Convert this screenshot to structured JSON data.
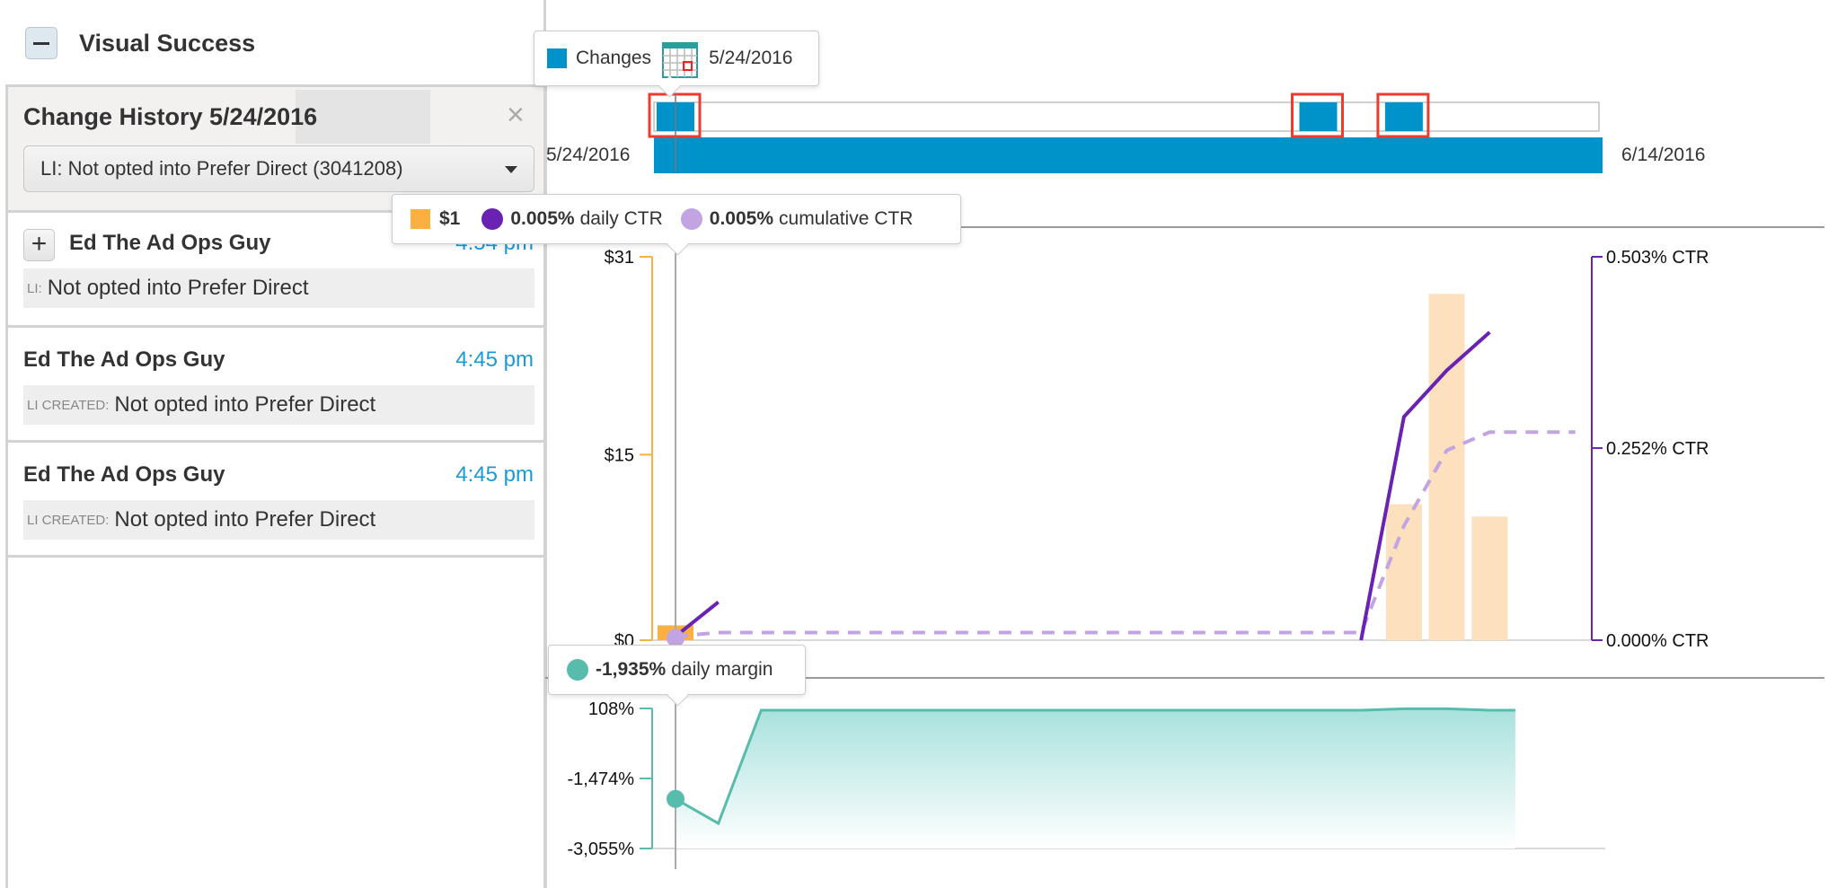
{
  "header": {
    "title": "Visual Success",
    "collapse_icon": "minus-icon"
  },
  "history": {
    "title": "Change History 5/24/2016",
    "close_icon": "close-icon",
    "select_value": "LI: Not opted into Prefer Direct (3041208)",
    "entries": [
      {
        "author": "Ed The Ad Ops Guy",
        "time": "4:54 pm",
        "tag": "LI:",
        "text": "Not opted into Prefer Direct",
        "expandable": true
      },
      {
        "author": "Ed The Ad Ops Guy",
        "time": "4:45 pm",
        "tag": "LI CREATED:",
        "text": "Not opted into Prefer Direct",
        "expandable": false
      },
      {
        "author": "Ed The Ad Ops Guy",
        "time": "4:45 pm",
        "tag": "LI CREATED:",
        "text": "Not opted into Prefer Direct",
        "expandable": false
      }
    ]
  },
  "tooltips": {
    "changes": {
      "label": "Changes",
      "icon": "calendar-icon",
      "date": "5/24/2016"
    },
    "metrics": {
      "spend": "$1",
      "daily_ctr_value": "0.005%",
      "daily_ctr_label": "daily CTR",
      "cum_ctr_value": "0.005%",
      "cum_ctr_label": "cumulative CTR"
    },
    "margin": {
      "value": "-1,935%",
      "label": "daily margin"
    }
  },
  "colors": {
    "changes": "#0093c9",
    "highlight": "#f03a2e",
    "spend": "#fbb040",
    "spend_faded": "#fde0bd",
    "daily_ctr": "#6a22b3",
    "cumulative_ctr": "#c1a4e1",
    "margin": "#58bcad"
  },
  "chart_data": [
    {
      "type": "timeline",
      "title": "Changes",
      "start_label": "5/24/2016",
      "end_label": "6/14/2016",
      "days": 22,
      "change_days": [
        0,
        15,
        17
      ],
      "highlighted_days": [
        0,
        15,
        17
      ],
      "selected_day": 0
    },
    {
      "type": "bar+line",
      "x_label_start": "5/24/2016",
      "x_label_end": "6/14/2016",
      "left_axis": {
        "label": "spend",
        "ticks": [
          "$0",
          "$15",
          "$31"
        ],
        "range": [
          0,
          31
        ]
      },
      "right_axis": {
        "label": "CTR",
        "ticks": [
          "0.000% CTR",
          "0.252% CTR",
          "0.503% CTR"
        ],
        "range": [
          0,
          0.503
        ]
      },
      "series": [
        {
          "name": "spend",
          "type": "bar",
          "unit": "$",
          "points": [
            {
              "day": 0,
              "value": 1.2
            },
            {
              "day": 17,
              "value": 11
            },
            {
              "day": 18,
              "value": 28
            },
            {
              "day": 19,
              "value": 10
            }
          ]
        },
        {
          "name": "daily CTR",
          "type": "line",
          "unit": "%",
          "segments": [
            [
              {
                "day": 0,
                "value": 0.005
              },
              {
                "day": 1,
                "value": 0.05
              }
            ],
            [
              {
                "day": 16,
                "value": 0.0
              },
              {
                "day": 17,
                "value": 0.293
              },
              {
                "day": 18,
                "value": 0.354
              },
              {
                "day": 19,
                "value": 0.404
              }
            ]
          ]
        },
        {
          "name": "cumulative CTR",
          "type": "dashed-line",
          "unit": "%",
          "points": [
            {
              "day": 0,
              "value": 0.005
            },
            {
              "day": 1,
              "value": 0.01
            },
            {
              "day": 16,
              "value": 0.01
            },
            {
              "day": 17,
              "value": 0.15
            },
            {
              "day": 18,
              "value": 0.249
            },
            {
              "day": 19,
              "value": 0.273
            },
            {
              "day": 21,
              "value": 0.273
            }
          ]
        }
      ],
      "selected_day": 0
    },
    {
      "type": "area",
      "axis": {
        "ticks": [
          "108%",
          "-1,474%",
          "-3,055%"
        ],
        "range": [
          -3055,
          108
        ]
      },
      "series": [
        {
          "name": "daily margin",
          "unit": "%",
          "points": [
            {
              "day": 0,
              "value": -1935
            },
            {
              "day": 1,
              "value": -2488
            },
            {
              "day": 2,
              "value": 67
            },
            {
              "day": 3,
              "value": 67
            },
            {
              "day": 4,
              "value": 67
            },
            {
              "day": 5,
              "value": 67
            },
            {
              "day": 6,
              "value": 67
            },
            {
              "day": 7,
              "value": 67
            },
            {
              "day": 8,
              "value": 67
            },
            {
              "day": 9,
              "value": 67
            },
            {
              "day": 10,
              "value": 67
            },
            {
              "day": 11,
              "value": 67
            },
            {
              "day": 12,
              "value": 67
            },
            {
              "day": 13,
              "value": 67
            },
            {
              "day": 14,
              "value": 67
            },
            {
              "day": 15,
              "value": 67
            },
            {
              "day": 16,
              "value": 67
            },
            {
              "day": 17,
              "value": 100
            },
            {
              "day": 18,
              "value": 100
            },
            {
              "day": 19,
              "value": 67
            },
            {
              "day": 19.6,
              "value": 67
            }
          ]
        }
      ],
      "selected_day": 0
    }
  ]
}
